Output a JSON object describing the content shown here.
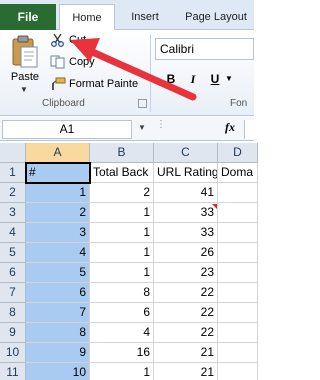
{
  "ribbon": {
    "tabs": {
      "file": "File",
      "home": "Home",
      "insert": "Insert",
      "page_layout": "Page Layout"
    },
    "clipboard": {
      "paste": "Paste",
      "cut": "Cut",
      "copy": "Copy",
      "format_painter": "Format Painte",
      "group_label": "Clipboard"
    },
    "font": {
      "name": "Calibri",
      "bold": "B",
      "italic": "I",
      "underline": "U",
      "group_label": "Fon"
    }
  },
  "formula_bar": {
    "name_box": "A1",
    "fx": "fx",
    "content": ""
  },
  "sheet": {
    "columns": [
      "A",
      "B",
      "C",
      "D"
    ],
    "selected_column": "A",
    "rows": [
      {
        "num": "1",
        "cells": [
          "#",
          "Total Back",
          "URL Rating",
          "Doma"
        ]
      },
      {
        "num": "2",
        "cells": [
          "1",
          "2",
          "41",
          ""
        ],
        "flag_c": false
      },
      {
        "num": "3",
        "cells": [
          "2",
          "1",
          "33",
          ""
        ],
        "flag_c": true
      },
      {
        "num": "4",
        "cells": [
          "3",
          "1",
          "33",
          ""
        ]
      },
      {
        "num": "5",
        "cells": [
          "4",
          "1",
          "26",
          ""
        ]
      },
      {
        "num": "6",
        "cells": [
          "5",
          "1",
          "23",
          ""
        ]
      },
      {
        "num": "7",
        "cells": [
          "6",
          "8",
          "22",
          ""
        ]
      },
      {
        "num": "8",
        "cells": [
          "7",
          "6",
          "22",
          ""
        ]
      },
      {
        "num": "9",
        "cells": [
          "8",
          "4",
          "22",
          ""
        ]
      },
      {
        "num": "10",
        "cells": [
          "9",
          "16",
          "21",
          ""
        ]
      },
      {
        "num": "11",
        "cells": [
          "10",
          "1",
          "21",
          ""
        ]
      }
    ]
  },
  "colors": {
    "file_tab": "#2a6b32",
    "selection": "#a9cbf2",
    "annotation_arrow": "#e8333d"
  }
}
